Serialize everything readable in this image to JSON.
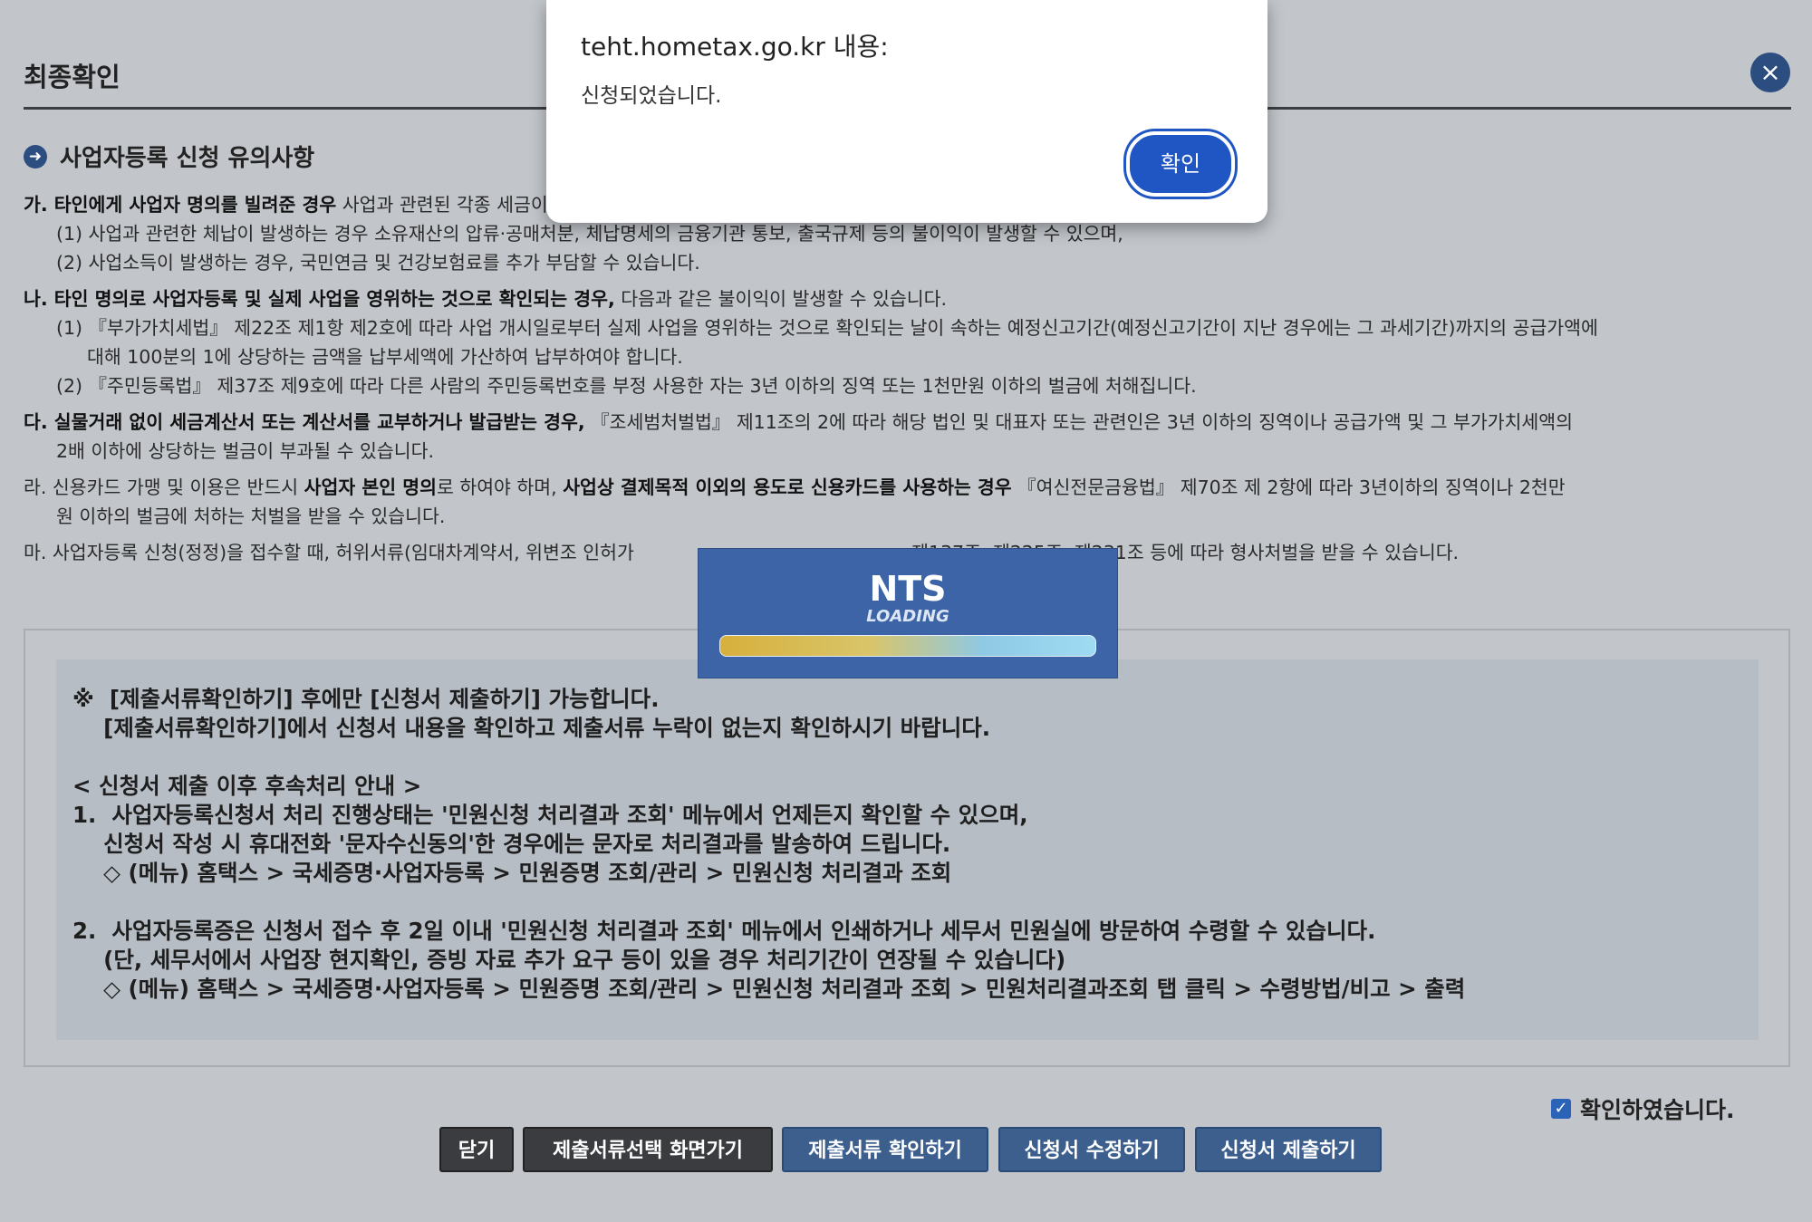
{
  "page": {
    "title": "최종확인",
    "close_label": "×",
    "section_title": "사업자등록 신청 유의사항"
  },
  "notes": {
    "ga_bold": "가. 타인에게 사업자 명의를 빌려준 경우",
    "ga_rest": " 사업과 관련된 각종 세금이 명의를 빌려준 사람에게 나오게 되어",
    "ga_1": "(1) 사업과 관련한 체납이 발생하는 경우 소유재산의 압류·공매처분, 체납명세의 금융기관 통보, 출국규제 등의 불이익이 발생할 수 있으며,",
    "ga_2": "(2) 사업소득이 발생하는 경우, 국민연금 및 건강보험료를 추가 부담할 수 있습니다.",
    "na_bold": "나. 타인 명의로 사업자등록 및 실제 사업을 영위하는 것으로 확인되는 경우,",
    "na_rest": " 다음과 같은 불이익이 발생할 수 있습니다.",
    "na_1a": "(1) 『부가가치세법』 제22조 제1항 제2호에 따라 사업 개시일로부터 실제 사업을 영위하는 것으로 확인되는 날이 속하는 예정신고기간(예정신고기간이 지난 경우에는 그 과세기간)까지의 공급가액에",
    "na_1b": "대해 100분의 1에 상당하는 금액을 납부세액에 가산하여 납부하여야 합니다.",
    "na_2": "(2) 『주민등록법』 제37조 제9호에 따라 다른 사람의 주민등록번호를 부정 사용한 자는 3년 이하의 징역 또는 1천만원 이하의 벌금에 처해집니다.",
    "da_bold": "다. 실물거래 없이 세금계산서 또는 계산서를 교부하거나 발급받는 경우,",
    "da_rest": " 『조세범처벌법』 제11조의 2에 따라 해당 법인 및 대표자 또는 관련인은 3년 이하의 징역이나 공급가액 및 그 부가가치세액의",
    "da_cont": "2배 이하에 상당하는 벌금이 부과될 수 있습니다.",
    "ra_pre": "라. 신용카드 가맹 및 이용은 반드시 ",
    "ra_bold1": "사업자 본인 명의",
    "ra_mid": "로 하여야 하며, ",
    "ra_bold2": "사업상 결제목적 이외의 용도로 신용카드를 사용하는 경우",
    "ra_rest": " 『여신전문금융법』 제70조 제 2항에 따라 3년이하의 징역이나 2천만",
    "ra_cont": "원 이하의 벌금에 처하는 처벌을 받을 수 있습니다.",
    "ma": "마. 사업자등록 신청(정정)을 접수할 때, 허위서류(임대차계약서, 위변조 인허가                                               제137조, 제225조, 제231조 등에 따라 형사처벌을 받을 수 있습니다."
  },
  "guide_text": "※  [제출서류확인하기] 후에만 [신청서 제출하기] 가능합니다.\n    [제출서류확인하기]에서 신청서 내용을 확인하고 제출서류 누락이 없는지 확인하시기 바랍니다.\n\n< 신청서 제출 이후 후속처리 안내 >\n1.  사업자등록신청서 처리 진행상태는 '민원신청 처리결과 조회' 메뉴에서 언제든지 확인할 수 있으며,\n    신청서 작성 시 휴대전화 '문자수신동의'한 경우에는 문자로 처리결과를 발송하여 드립니다.\n    ◇ (메뉴) 홈택스 > 국세증명·사업자등록 > 민원증명 조회/관리 > 민원신청 처리결과 조회\n\n2.  사업자등록증은 신청서 접수 후 2일 이내 '민원신청 처리결과 조회' 메뉴에서 인쇄하거나 세무서 민원실에 방문하여 수령할 수 있습니다.\n    (단, 세무서에서 사업장 현지확인, 증빙 자료 추가 요구 등이 있을 경우 처리기간이 연장될 수 있습니다)\n    ◇ (메뉴) 홈택스 > 국세증명·사업자등록 > 민원증명 조회/관리 > 민원신청 처리결과 조회 > 민원처리결과조회 탭 클릭 > 수령방법/비고 > 출력",
  "confirm_checkbox": {
    "label": "확인하였습니다.",
    "checked": true
  },
  "buttons": {
    "close": "닫기",
    "go_select": "제출서류선택 화면가기",
    "check_docs": "제출서류 확인하기",
    "edit": "신청서 수정하기",
    "submit": "신청서 제출하기"
  },
  "loading": {
    "logo": "NTS",
    "text": "LOADING"
  },
  "dialog": {
    "header": "teht.hometax.go.kr 내용:",
    "message": "신청되었습니다.",
    "ok_label": "확인"
  },
  "colors": {
    "accent": "#2c4d80",
    "dialog_button": "#1f56c4",
    "overlay": "#c2c6cb"
  }
}
